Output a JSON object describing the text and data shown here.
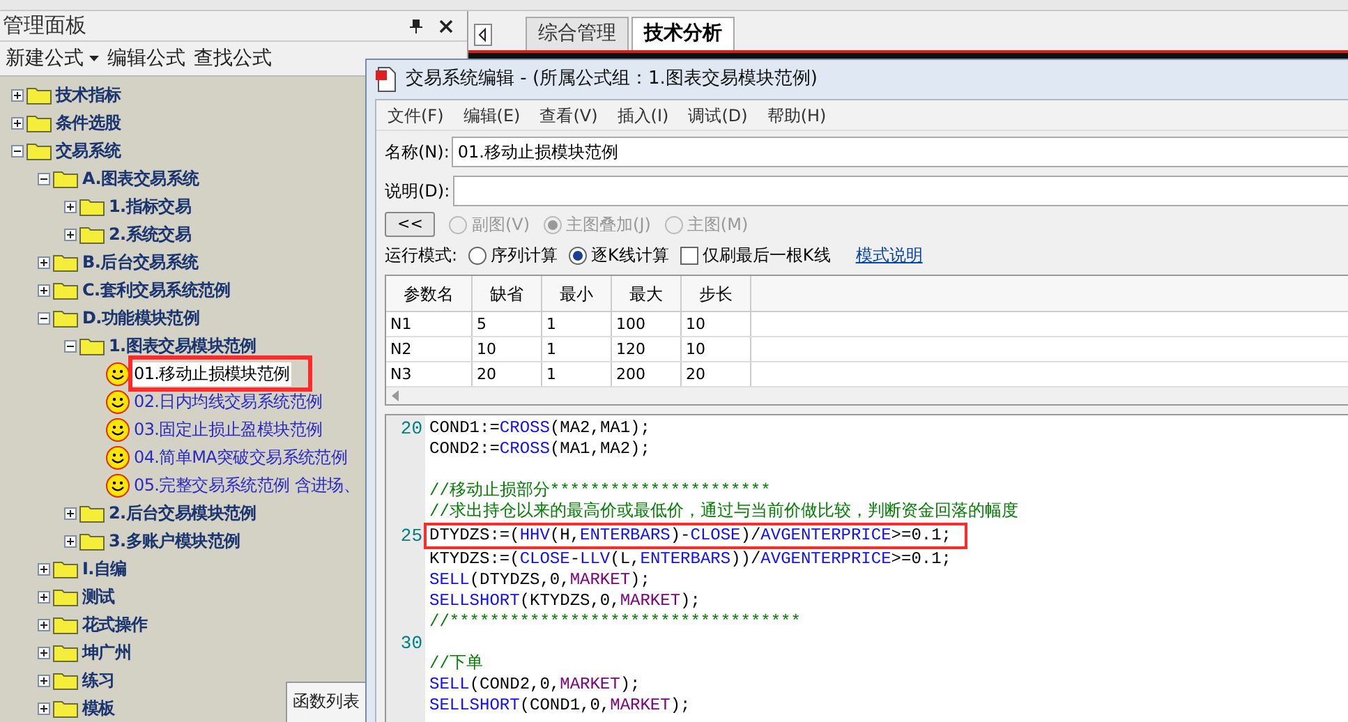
{
  "panel": {
    "title": "管理面板",
    "toolbar": [
      {
        "label": "新建公式",
        "dropdown": true
      },
      {
        "label": "编辑公式",
        "dropdown": false
      },
      {
        "label": "查找公式",
        "dropdown": false
      }
    ]
  },
  "tree": [
    {
      "label": "技术指标",
      "kind": "folder",
      "expanded": false,
      "selected": false
    },
    {
      "label": "条件选股",
      "kind": "folder",
      "expanded": false,
      "selected": false
    },
    {
      "label": "交易系统",
      "kind": "folder",
      "expanded": true,
      "selected": false,
      "children": [
        {
          "label": "A.图表交易系统",
          "kind": "folder",
          "expanded": true,
          "selected": false,
          "children": [
            {
              "label": "1.指标交易",
              "kind": "folder",
              "expanded": false,
              "selected": false
            },
            {
              "label": "2.系统交易",
              "kind": "folder",
              "expanded": false,
              "selected": false
            }
          ]
        },
        {
          "label": "B.后台交易系统",
          "kind": "folder",
          "expanded": false,
          "selected": false
        },
        {
          "label": "C.套利交易系统范例",
          "kind": "folder",
          "expanded": false,
          "selected": false
        },
        {
          "label": "D.功能模块范例",
          "kind": "folder",
          "expanded": true,
          "selected": false,
          "children": [
            {
              "label": "1.图表交易模块范例",
              "kind": "folder",
              "expanded": true,
              "selected": false,
              "children": [
                {
                  "label": "01.移动止损模块范例",
                  "kind": "formula",
                  "selected": true
                },
                {
                  "label": "02.日内均线交易系统范例",
                  "kind": "formula",
                  "selected": false
                },
                {
                  "label": "03.固定止损止盈模块范例",
                  "kind": "formula",
                  "selected": false
                },
                {
                  "label": "04.简单MA突破交易系统范例",
                  "kind": "formula",
                  "selected": false
                },
                {
                  "label": "05.完整交易系统范例 含进场、",
                  "kind": "formula",
                  "selected": false
                }
              ]
            },
            {
              "label": "2.后台交易模块范例",
              "kind": "folder",
              "expanded": false,
              "selected": false
            },
            {
              "label": "3.多账户模块范例",
              "kind": "folder",
              "expanded": false,
              "selected": false
            }
          ]
        },
        {
          "label": "I.自编",
          "kind": "folder",
          "expanded": false,
          "selected": false
        },
        {
          "label": "测试",
          "kind": "folder",
          "expanded": false,
          "selected": false
        },
        {
          "label": "花式操作",
          "kind": "folder",
          "expanded": false,
          "selected": false
        },
        {
          "label": "坤广州",
          "kind": "folder",
          "expanded": false,
          "selected": false
        },
        {
          "label": "练习",
          "kind": "folder",
          "expanded": false,
          "selected": false
        },
        {
          "label": "模板",
          "kind": "folder",
          "expanded": false,
          "selected": false
        }
      ]
    }
  ],
  "function_list_window": {
    "title": "函数列表"
  },
  "tabs": [
    {
      "label": "综合管理",
      "selected": false
    },
    {
      "label": "技术分析",
      "selected": true
    }
  ],
  "dialog": {
    "title": "交易系统编辑 - (所属公式组：1.图表交易模块范例)",
    "menu": [
      "文件(F)",
      "编辑(E)",
      "查看(V)",
      "插入(I)",
      "调试(D)",
      "帮助(H)"
    ],
    "name_label": "名称(N):",
    "name_value": "01.移动止损模块范例",
    "desc_label": "说明(D):",
    "collapse_button": "<<",
    "chart_options": [
      {
        "label": "副图(V)",
        "selected": false
      },
      {
        "label": "主图叠加(J)",
        "selected": true
      },
      {
        "label": "主图(M)",
        "selected": false
      }
    ],
    "run_mode_label": "运行模式:",
    "run_modes": [
      {
        "label": "序列计算",
        "selected": false
      },
      {
        "label": "逐K线计算",
        "selected": true
      }
    ],
    "refresh_last": {
      "label": "仅刷最后一根K线",
      "checked": false
    },
    "mode_link": "模式说明",
    "params": {
      "columns": [
        "参数名",
        "缺省",
        "最小",
        "最大",
        "步长"
      ],
      "rows": [
        [
          "N1",
          "5",
          "1",
          "100",
          "10"
        ],
        [
          "N2",
          "10",
          "1",
          "120",
          "10"
        ],
        [
          "N3",
          "20",
          "1",
          "200",
          "20"
        ]
      ]
    },
    "code": [
      {
        "number": "20",
        "tokens": [
          {
            "kind": "plain",
            "text": "COND1:="
          },
          {
            "kind": "function",
            "text": "CROSS"
          },
          {
            "kind": "plain",
            "text": "(MA2,MA1);"
          }
        ]
      },
      {
        "tokens": [
          {
            "kind": "plain",
            "text": "COND2:="
          },
          {
            "kind": "function",
            "text": "CROSS"
          },
          {
            "kind": "plain",
            "text": "(MA1,MA2);"
          }
        ]
      },
      {
        "kind": "blank"
      },
      {
        "tokens": [
          {
            "kind": "comment",
            "text": "//移动止损部分**********************"
          }
        ]
      },
      {
        "tokens": [
          {
            "kind": "comment",
            "text": "//求出持仓以来的最高价或最低价，通过与当前价做比较，判断资金回落的幅度"
          }
        ]
      },
      {
        "number": "25",
        "tokens": [
          {
            "kind": "plain",
            "text": "DTYDZS:=("
          },
          {
            "kind": "function",
            "text": "HHV"
          },
          {
            "kind": "plain",
            "text": "(H,"
          },
          {
            "kind": "function",
            "text": "ENTERBARS"
          },
          {
            "kind": "plain",
            "text": ")-"
          },
          {
            "kind": "function",
            "text": "CLOSE"
          },
          {
            "kind": "plain",
            "text": ")/"
          },
          {
            "kind": "function",
            "text": "AVGENTERPRICE"
          },
          {
            "kind": "plain",
            "text": ">=0.1;"
          }
        ]
      },
      {
        "tokens": [
          {
            "kind": "plain",
            "text": "KTYDZS:=("
          },
          {
            "kind": "function",
            "text": "CLOSE"
          },
          {
            "kind": "plain",
            "text": "-"
          },
          {
            "kind": "function",
            "text": "LLV"
          },
          {
            "kind": "plain",
            "text": "(L,"
          },
          {
            "kind": "function",
            "text": "ENTERBARS"
          },
          {
            "kind": "plain",
            "text": "))/"
          },
          {
            "kind": "function",
            "text": "AVGENTERPRICE"
          },
          {
            "kind": "plain",
            "text": ">=0.1;"
          }
        ]
      },
      {
        "tokens": [
          {
            "kind": "function",
            "text": "SELL"
          },
          {
            "kind": "plain",
            "text": "(DTYDZS,0,"
          },
          {
            "kind": "constant",
            "text": "MARKET"
          },
          {
            "kind": "plain",
            "text": ");"
          }
        ]
      },
      {
        "tokens": [
          {
            "kind": "function",
            "text": "SELLSHORT"
          },
          {
            "kind": "plain",
            "text": "(KTYDZS,0,"
          },
          {
            "kind": "constant",
            "text": "MARKET"
          },
          {
            "kind": "plain",
            "text": ");"
          }
        ]
      },
      {
        "tokens": [
          {
            "kind": "comment",
            "text": "//***********************************"
          }
        ]
      },
      {
        "number": "30",
        "kind": "blank"
      },
      {
        "tokens": [
          {
            "kind": "comment",
            "text": "//下单"
          }
        ]
      },
      {
        "tokens": [
          {
            "kind": "function",
            "text": "SELL"
          },
          {
            "kind": "plain",
            "text": "(COND2,0,"
          },
          {
            "kind": "constant",
            "text": "MARKET"
          },
          {
            "kind": "plain",
            "text": ");"
          }
        ]
      },
      {
        "tokens": [
          {
            "kind": "function",
            "text": "SELLSHORT"
          },
          {
            "kind": "plain",
            "text": "(COND1,0,"
          },
          {
            "kind": "constant",
            "text": "MARKET"
          },
          {
            "kind": "plain",
            "text": ");"
          }
        ]
      }
    ]
  }
}
